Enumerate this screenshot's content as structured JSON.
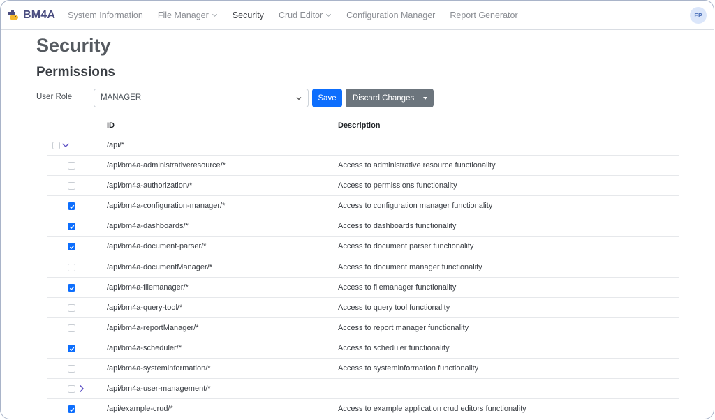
{
  "navbar": {
    "brand": "BM4A",
    "items": [
      {
        "label": "System Information",
        "dropdown": false,
        "active": false
      },
      {
        "label": "File Manager",
        "dropdown": true,
        "active": false
      },
      {
        "label": "Security",
        "dropdown": false,
        "active": true
      },
      {
        "label": "Crud Editor",
        "dropdown": true,
        "active": false
      },
      {
        "label": "Configuration Manager",
        "dropdown": false,
        "active": false
      },
      {
        "label": "Report Generator",
        "dropdown": false,
        "active": false
      }
    ],
    "avatar_initials": "EP"
  },
  "page": {
    "title": "Security",
    "section_title": "Permissions"
  },
  "role": {
    "label": "User Role",
    "selected": "MANAGER",
    "save_label": "Save",
    "discard_label": "Discard Changes"
  },
  "table": {
    "headers": {
      "id": "ID",
      "description": "Description"
    },
    "rows": [
      {
        "id": "/api/*",
        "description": "",
        "checked": false,
        "level": "parent",
        "expander": "expanded"
      },
      {
        "id": "/api/bm4a-administrativeresource/*",
        "description": "Access to administrative resource functionality",
        "checked": false,
        "level": "child",
        "expander": "none"
      },
      {
        "id": "/api/bm4a-authorization/*",
        "description": "Access to permissions functionality",
        "checked": false,
        "level": "child",
        "expander": "none"
      },
      {
        "id": "/api/bm4a-configuration-manager/*",
        "description": "Access to configuration manager functionality",
        "checked": true,
        "level": "child",
        "expander": "none"
      },
      {
        "id": "/api/bm4a-dashboards/*",
        "description": "Access to dashboards functionality",
        "checked": true,
        "level": "child",
        "expander": "none"
      },
      {
        "id": "/api/bm4a-document-parser/*",
        "description": "Access to document parser functionality",
        "checked": true,
        "level": "child",
        "expander": "none"
      },
      {
        "id": "/api/bm4a-documentManager/*",
        "description": "Access to document manager functionality",
        "checked": false,
        "level": "child",
        "expander": "none"
      },
      {
        "id": "/api/bm4a-filemanager/*",
        "description": "Access to filemanager functionality",
        "checked": true,
        "level": "child",
        "expander": "none"
      },
      {
        "id": "/api/bm4a-query-tool/*",
        "description": "Access to query tool functionality",
        "checked": false,
        "level": "child",
        "expander": "none"
      },
      {
        "id": "/api/bm4a-reportManager/*",
        "description": "Access to report manager functionality",
        "checked": false,
        "level": "child",
        "expander": "none"
      },
      {
        "id": "/api/bm4a-scheduler/*",
        "description": "Access to scheduler functionality",
        "checked": true,
        "level": "child",
        "expander": "none"
      },
      {
        "id": "/api/bm4a-systeminformation/*",
        "description": "Access to systeminformation functionality",
        "checked": false,
        "level": "child",
        "expander": "none"
      },
      {
        "id": "/api/bm4a-user-management/*",
        "description": "",
        "checked": false,
        "level": "child",
        "expander": "collapsed"
      },
      {
        "id": "/api/example-crud/*",
        "description": "Access to example application crud editors functionality",
        "checked": true,
        "level": "child",
        "expander": "none"
      }
    ]
  },
  "colors": {
    "primary": "#0d6efd",
    "secondary": "#6c757d",
    "brand": "#4a4d80",
    "expander": "#5b4fc4"
  }
}
